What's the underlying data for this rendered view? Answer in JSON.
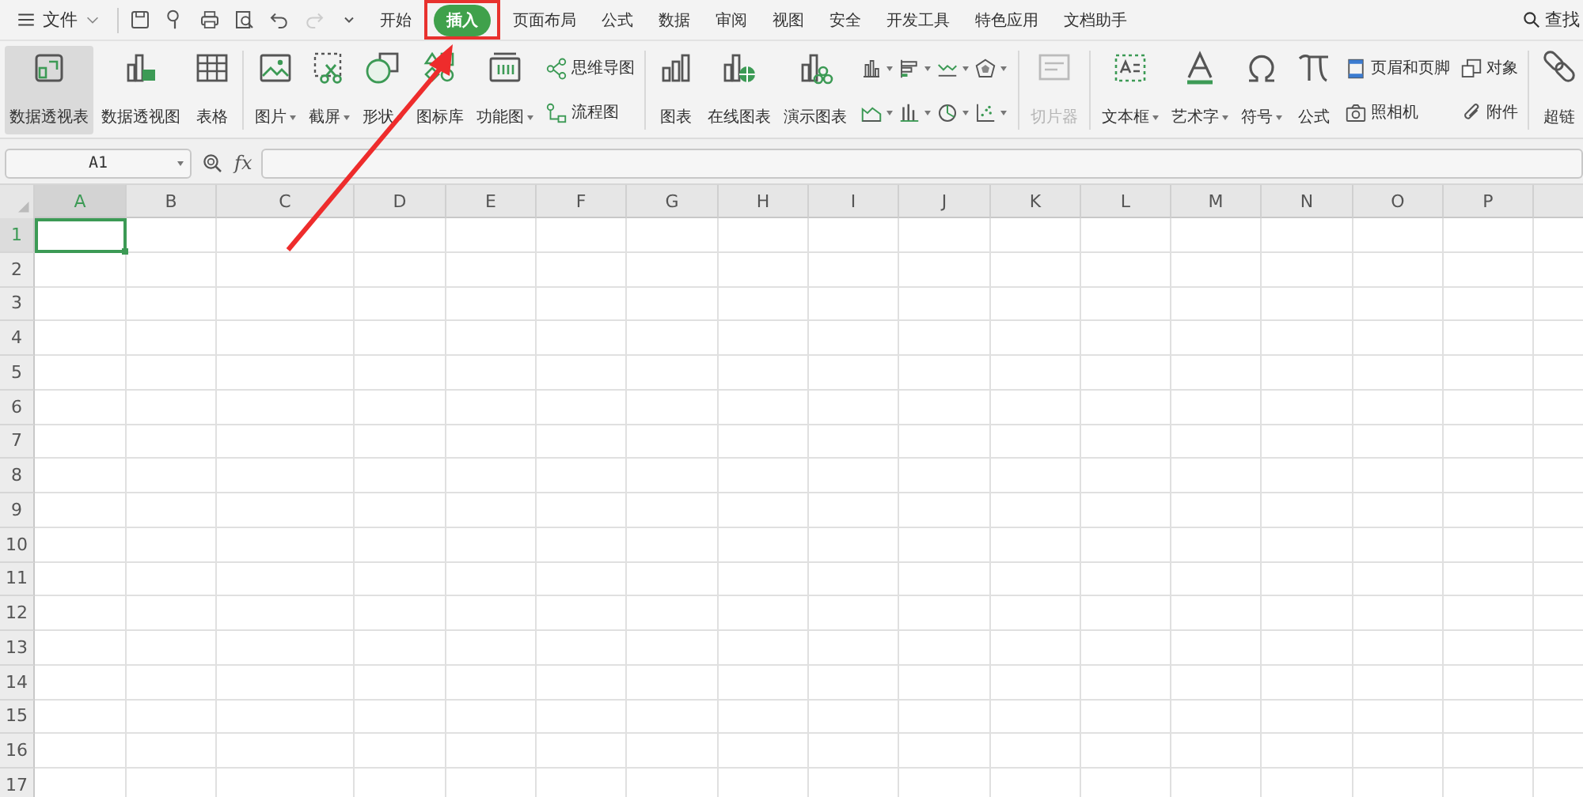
{
  "menu_bar": {
    "file_menu": "文件",
    "quick_access": [
      {
        "disabled": false
      },
      {
        "disabled": false
      },
      {
        "disabled": false
      },
      {
        "disabled": false
      },
      {
        "disabled": false
      },
      {
        "disabled": true
      },
      {
        "disabled": false
      }
    ],
    "tabs": [
      {
        "label": "开始",
        "selected": false
      },
      {
        "label": "插入",
        "selected": true
      },
      {
        "label": "页面布局",
        "selected": false
      },
      {
        "label": "公式",
        "selected": false
      },
      {
        "label": "数据",
        "selected": false
      },
      {
        "label": "审阅",
        "selected": false
      },
      {
        "label": "视图",
        "selected": false
      },
      {
        "label": "安全",
        "selected": false
      },
      {
        "label": "开发工具",
        "selected": false
      },
      {
        "label": "特色应用",
        "selected": false
      },
      {
        "label": "文档助手",
        "selected": false
      }
    ],
    "search": "查找"
  },
  "ribbon": {
    "groups": [
      {
        "items": [
          {
            "kind": "large",
            "label": "数据透视表",
            "selected": true,
            "dropdown": false,
            "disabled": false
          },
          {
            "kind": "large",
            "label": "数据透视图",
            "selected": false,
            "dropdown": false,
            "disabled": false
          },
          {
            "kind": "large",
            "label": "表格",
            "selected": false,
            "dropdown": false,
            "disabled": false
          }
        ]
      },
      {
        "items": [
          {
            "kind": "large",
            "label": "图片",
            "selected": false,
            "dropdown": true,
            "disabled": false
          },
          {
            "kind": "large",
            "label": "截屏",
            "selected": false,
            "dropdown": true,
            "disabled": false
          },
          {
            "kind": "large",
            "label": "形状",
            "selected": false,
            "dropdown": true,
            "disabled": false
          },
          {
            "kind": "large",
            "label": "图标库",
            "selected": false,
            "dropdown": false,
            "disabled": false
          },
          {
            "kind": "large",
            "label": "功能图",
            "selected": false,
            "dropdown": true,
            "disabled": false
          },
          {
            "kind": "stack",
            "items": [
              {
                "label": "思维导图"
              },
              {
                "label": "流程图"
              }
            ]
          }
        ]
      },
      {
        "items": [
          {
            "kind": "large",
            "label": "图表",
            "selected": false,
            "dropdown": false,
            "disabled": false
          },
          {
            "kind": "large",
            "label": "在线图表",
            "selected": false,
            "dropdown": false,
            "disabled": false
          },
          {
            "kind": "large",
            "label": "演示图表",
            "selected": false,
            "dropdown": false,
            "disabled": false
          },
          {
            "kind": "icon-grid",
            "items": [
              {
                "dropdown": true
              },
              {
                "dropdown": true
              },
              {
                "dropdown": true
              },
              {
                "dropdown": true
              },
              {
                "dropdown": true
              },
              {
                "dropdown": true
              },
              {
                "dropdown": true
              },
              {
                "dropdown": true
              }
            ]
          }
        ]
      },
      {
        "items": [
          {
            "kind": "large",
            "label": "切片器",
            "selected": false,
            "dropdown": false,
            "disabled": true
          }
        ]
      },
      {
        "items": [
          {
            "kind": "large",
            "label": "文本框",
            "selected": false,
            "dropdown": true,
            "disabled": false
          },
          {
            "kind": "large",
            "label": "艺术字",
            "selected": false,
            "dropdown": true,
            "disabled": false
          },
          {
            "kind": "large",
            "label": "符号",
            "selected": false,
            "dropdown": true,
            "disabled": false
          },
          {
            "kind": "large",
            "label": "公式",
            "selected": false,
            "dropdown": false,
            "disabled": false
          },
          {
            "kind": "stack",
            "items": [
              {
                "label": "页眉和页脚"
              },
              {
                "label": "照相机"
              }
            ]
          },
          {
            "kind": "stack",
            "items": [
              {
                "label": "对象"
              },
              {
                "label": "附件"
              }
            ]
          }
        ]
      },
      {
        "items": [
          {
            "kind": "large",
            "label": "超链",
            "selected": false,
            "dropdown": false,
            "disabled": false
          }
        ]
      }
    ]
  },
  "formula_bar": {
    "name_box": "A1",
    "fx": "fx"
  },
  "sheet": {
    "columns": [
      {
        "label": "A",
        "selected": true
      },
      {
        "label": "B",
        "selected": false
      },
      {
        "label": "C",
        "selected": false
      },
      {
        "label": "D",
        "selected": false
      },
      {
        "label": "E",
        "selected": false
      },
      {
        "label": "F",
        "selected": false
      },
      {
        "label": "G",
        "selected": false
      },
      {
        "label": "H",
        "selected": false
      },
      {
        "label": "I",
        "selected": false
      },
      {
        "label": "J",
        "selected": false
      },
      {
        "label": "K",
        "selected": false
      },
      {
        "label": "L",
        "selected": false
      },
      {
        "label": "M",
        "selected": false
      },
      {
        "label": "N",
        "selected": false
      },
      {
        "label": "O",
        "selected": false
      },
      {
        "label": "P",
        "selected": false
      }
    ],
    "rows": [
      {
        "label": "1",
        "selected": true
      },
      {
        "label": "2",
        "selected": false
      },
      {
        "label": "3",
        "selected": false
      },
      {
        "label": "4",
        "selected": false
      },
      {
        "label": "5",
        "selected": false
      },
      {
        "label": "6",
        "selected": false
      },
      {
        "label": "7",
        "selected": false
      },
      {
        "label": "8",
        "selected": false
      },
      {
        "label": "9",
        "selected": false
      },
      {
        "label": "10",
        "selected": false
      },
      {
        "label": "11",
        "selected": false
      },
      {
        "label": "12",
        "selected": false
      },
      {
        "label": "13",
        "selected": false
      },
      {
        "label": "14",
        "selected": false
      },
      {
        "label": "15",
        "selected": false
      },
      {
        "label": "16",
        "selected": false
      },
      {
        "label": "17",
        "selected": false
      }
    ]
  },
  "annotation": {
    "arrow": true,
    "highlight_box": true
  }
}
